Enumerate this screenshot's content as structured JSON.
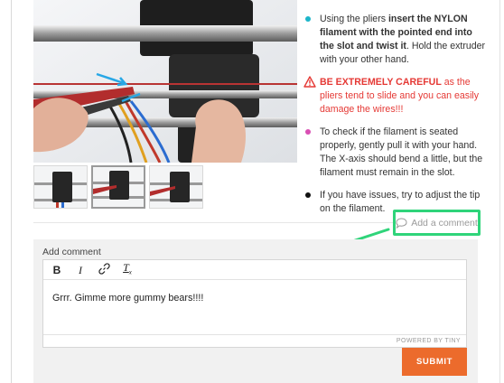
{
  "steps": [
    {
      "type": "info",
      "color": "#1cb5c9",
      "text_before": "Using the pliers ",
      "bold": "insert the NYLON filament with the pointed end into the slot and twist it",
      "text_after": ". Hold the extruder with your other hand."
    },
    {
      "type": "warning",
      "color": "#e53935",
      "bold": "BE EXTREMELY CAREFUL",
      "text_after": " as the pliers tend to slide and you can easily damage the wires!!!"
    },
    {
      "type": "check",
      "color": "#d94fb3",
      "text": "To check if the filament is seated properly, gently pull it with your hand. The X-axis should bend a little, but the filament must remain in the slot."
    },
    {
      "type": "note",
      "color": "#111111",
      "text": "If you have issues, try to adjust the tip on the filament."
    }
  ],
  "add_comment_link": {
    "label": "Add a comment",
    "highlight_color": "#2fd47a"
  },
  "comment_form": {
    "label": "Add comment",
    "toolbar": {
      "bold": "B",
      "italic": "I",
      "clear": "T"
    },
    "content": "Grrr. Gimme more gummy bears!!!!",
    "status": "POWERED BY TINY",
    "submit_label": "SUBMIT",
    "submit_color": "#ec6b2c"
  }
}
